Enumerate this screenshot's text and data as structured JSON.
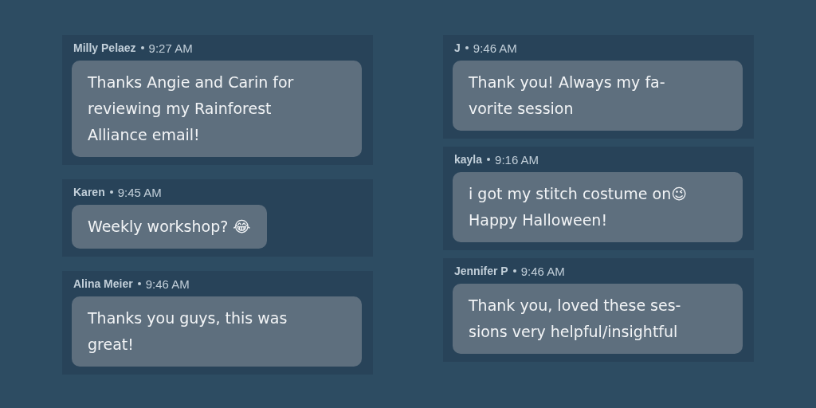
{
  "columns": [
    {
      "messages": [
        {
          "author": "Milly Pelaez",
          "time": "9:27 AM",
          "text": "Thanks Angie and Carin for\nreviewing my Rainforest\nAlliance email!"
        },
        {
          "author": "Karen",
          "time": "9:45 AM",
          "text": "Weekly workshop? 😂"
        },
        {
          "author": "Alina Meier",
          "time": "9:46 AM",
          "text": "Thanks you guys, this was\ngreat!"
        }
      ]
    },
    {
      "messages": [
        {
          "author": "J",
          "time": "9:46 AM",
          "text": "Thank you! Always my fa-\nvorite session"
        },
        {
          "author": "kayla",
          "time": "9:16 AM",
          "text": "i got my stitch costume on😉\nHappy Halloween!"
        },
        {
          "author": "Jennifer P",
          "time": "9:46 AM",
          "text": "Thank you, loved these ses-\nsions very helpful/insightful"
        }
      ]
    }
  ]
}
